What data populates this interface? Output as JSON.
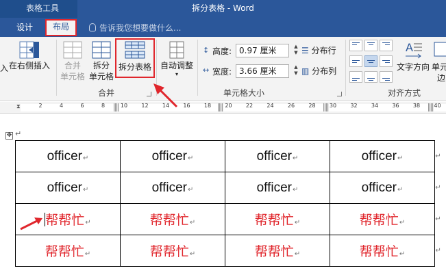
{
  "window": {
    "context_tab": "表格工具",
    "title": "拆分表格 - Word"
  },
  "tabs": {
    "design": "设计",
    "layout": "布局",
    "tell_me": "告诉我您想要做什么..."
  },
  "ribbon": {
    "insert_left_partial": "入",
    "insert_right_label": "在右侧插入",
    "merge_cells_line1": "合并",
    "merge_cells_line2": "单元格",
    "split_cells_line1": "拆分",
    "split_cells_line2": "单元格",
    "split_table_label": "拆分表格",
    "autofit_label": "自动调整",
    "merge_group_label": "合并",
    "height_label": "高度:",
    "height_value": "0.97 厘米",
    "width_label": "宽度:",
    "width_value": "3.66 厘米",
    "distribute_rows": "分布行",
    "distribute_cols": "分布列",
    "cell_size_group_label": "单元格大小",
    "text_direction_label": "文字方向",
    "cell_margins_partial": "单元",
    "cell_margins_partial2": "边",
    "alignment_group_label": "对齐方式"
  },
  "ruler": {
    "ticks": [
      "2",
      "4",
      "6",
      "8",
      "10",
      "12",
      "14",
      "16",
      "18",
      "20",
      "22",
      "24",
      "26",
      "28",
      "30",
      "32",
      "34",
      "36",
      "38",
      "40"
    ]
  },
  "table": {
    "rows": [
      [
        "officer",
        "officer",
        "officer",
        "officer"
      ],
      [
        "officer",
        "officer",
        "officer",
        "officer"
      ],
      [
        "帮帮忙",
        "帮帮忙",
        "帮帮忙",
        "帮帮忙"
      ],
      [
        "帮帮忙",
        "帮帮忙",
        "帮帮忙",
        "帮帮忙"
      ]
    ]
  },
  "colors": {
    "ribbon_blue": "#2b579a",
    "highlight_red": "#e0262c"
  }
}
